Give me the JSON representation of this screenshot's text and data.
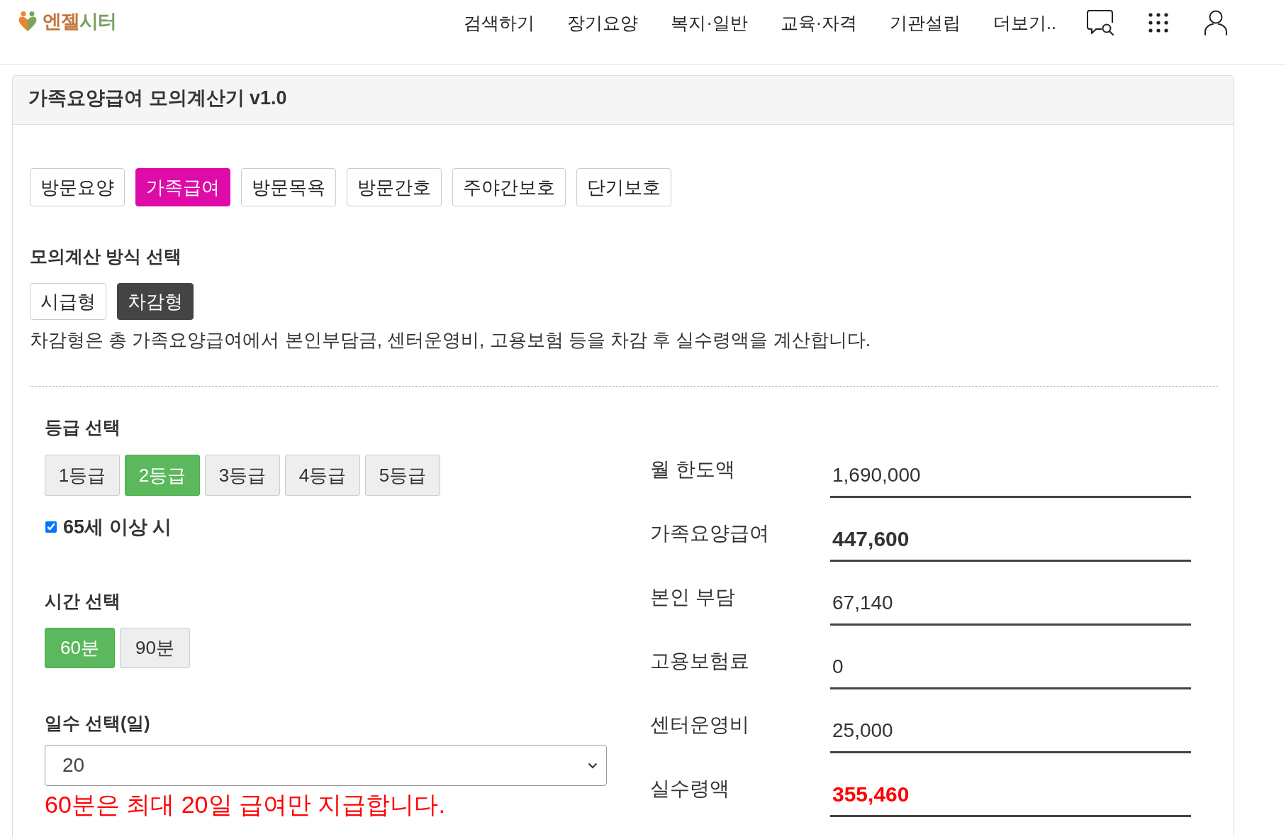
{
  "header": {
    "logo": {
      "parts": [
        "엔젤",
        "시터"
      ]
    },
    "nav": [
      "검색하기",
      "장기요양",
      "복지·일반",
      "교육·자격",
      "기관설립",
      "더보기.."
    ]
  },
  "card": {
    "title": "가족요양급여 모의계산기 v1.0"
  },
  "service_tabs": [
    {
      "label": "방문요양",
      "selected": false
    },
    {
      "label": "가족급여",
      "selected": true
    },
    {
      "label": "방문목욕",
      "selected": false
    },
    {
      "label": "방문간호",
      "selected": false
    },
    {
      "label": "주야간보호",
      "selected": false
    },
    {
      "label": "단기보호",
      "selected": false
    }
  ],
  "method": {
    "heading": "모의계산 방식 선택",
    "options": [
      {
        "label": "시급형",
        "selected": false
      },
      {
        "label": "차감형",
        "selected": true
      }
    ],
    "description": "차감형은 총 가족요양급여에서 본인부담금, 센터운영비, 고용보험 등을 차감 후 실수령액을 계산합니다."
  },
  "grade": {
    "heading": "등급 선택",
    "options": [
      {
        "label": "1등급",
        "selected": false
      },
      {
        "label": "2등급",
        "selected": true
      },
      {
        "label": "3등급",
        "selected": false
      },
      {
        "label": "4등급",
        "selected": false
      },
      {
        "label": "5등급",
        "selected": false
      }
    ],
    "age_option": {
      "label": "65세 이상 시",
      "checked": true
    }
  },
  "time": {
    "heading": "시간 선택",
    "options": [
      {
        "label": "60분",
        "selected": true
      },
      {
        "label": "90분",
        "selected": false
      }
    ]
  },
  "days": {
    "heading": "일수 선택(일)",
    "value": "20",
    "note": "60분은 최대 20일 급여만 지급합니다."
  },
  "results": [
    {
      "label": "월 한도액",
      "value": "1,690,000",
      "kind": "plain"
    },
    {
      "label": "가족요양급여",
      "value": "447,600",
      "kind": "emphasis"
    },
    {
      "label": "본인 부담",
      "value": "67,140",
      "kind": "plain"
    },
    {
      "label": "고용보험료",
      "value": "0",
      "kind": "plain"
    },
    {
      "label": "센터운영비",
      "value": "25,000",
      "kind": "plain"
    },
    {
      "label": "실수령액",
      "value": "355,460",
      "kind": "total"
    }
  ]
}
